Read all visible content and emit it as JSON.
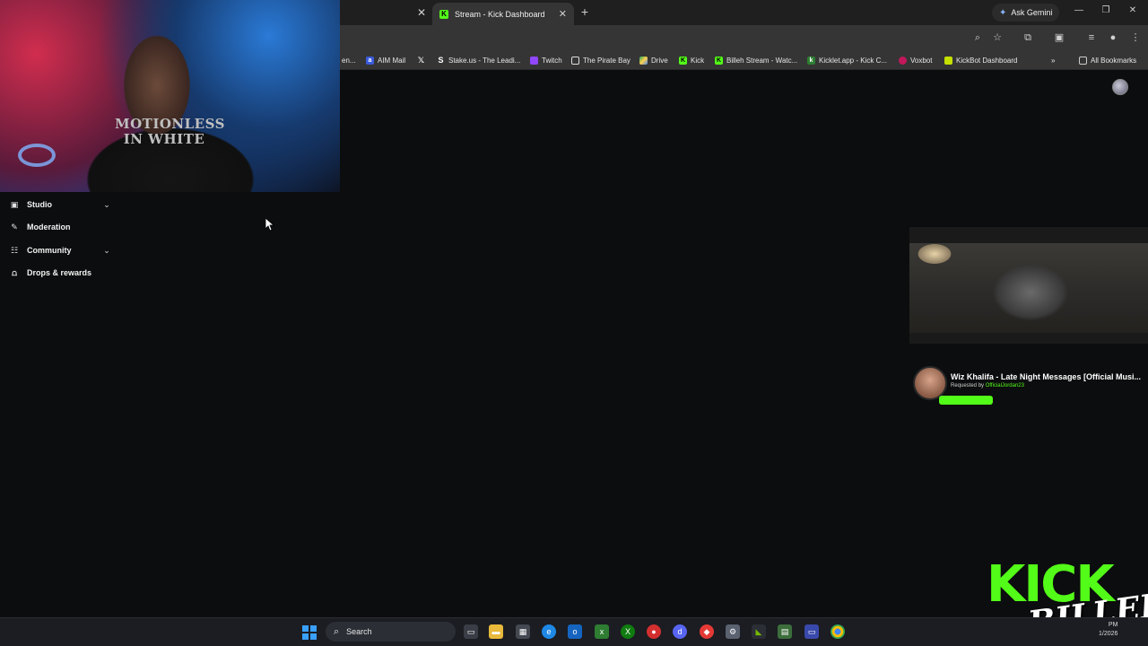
{
  "browser": {
    "active_tab_title": "Stream - Kick Dashboard",
    "ask_gemini": "Ask Gemini",
    "bookmarks": [
      {
        "label": "en...",
        "icon": "partial-bookmark-icon"
      },
      {
        "label": "AIM Mail",
        "icon": "aol-icon"
      },
      {
        "label": "",
        "icon": "x-icon"
      },
      {
        "label": "Stake.us - The Leadi...",
        "icon": "stake-icon"
      },
      {
        "label": "Twitch",
        "icon": "twitch-icon"
      },
      {
        "label": "The Pirate Bay",
        "icon": "pirate-bay-icon"
      },
      {
        "label": "Drive",
        "icon": "drive-icon"
      },
      {
        "label": "Kick",
        "icon": "kick-icon"
      },
      {
        "label": "Billeh Stream - Watc...",
        "icon": "kick-icon"
      },
      {
        "label": "Kicklet.app - Kick C...",
        "icon": "kicklet-icon"
      },
      {
        "label": "Voxbot",
        "icon": "voxbot-icon"
      },
      {
        "label": "KickBot Dashboard",
        "icon": "kickbot-icon"
      }
    ],
    "all_bookmarks": "All Bookmarks"
  },
  "sidebar": {
    "items": [
      {
        "label": "Studio",
        "icon": "studio-icon",
        "expandable": true
      },
      {
        "label": "Moderation",
        "icon": "wrench-icon",
        "expandable": false
      },
      {
        "label": "Community",
        "icon": "community-icon",
        "expandable": true
      },
      {
        "label": "Drops & rewards",
        "icon": "drops-icon",
        "expandable": false
      }
    ]
  },
  "webcam": {
    "shirt_text": "MOTIONLESS IN WHITE"
  },
  "music_widget": {
    "song_title": "Wiz Khalifa - Late Night Messages [Official Musi...",
    "requested_by_label": "Requested by",
    "requested_by_user": "OfficialJordan23"
  },
  "overlay_logo": {
    "line1": "KICK",
    "line2": "BILLEH"
  },
  "taskbar": {
    "search_label": "Search",
    "clock_time": "PM",
    "clock_date": "1/2026"
  },
  "colors": {
    "kick_green": "#53fc18",
    "page_bg": "#0c0d0e",
    "chrome_bg": "#353535"
  }
}
